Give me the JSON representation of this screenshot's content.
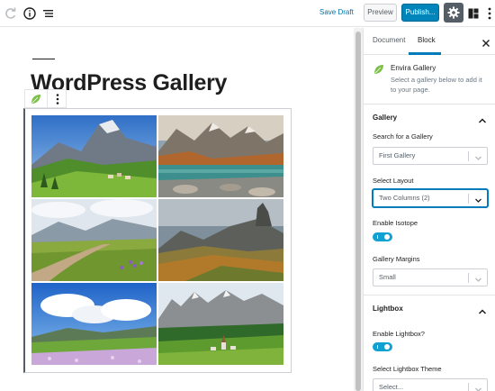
{
  "toolbar": {
    "save_draft": "Save Draft",
    "preview": "Preview",
    "publish": "Publish..."
  },
  "editor": {
    "post_title": "WordPress Gallery",
    "gallery_photos": [
      {
        "subject": "mountain village meadow"
      },
      {
        "subject": "alpine lake with rocks"
      },
      {
        "subject": "dirt road through valley"
      },
      {
        "subject": "rocky peaks autumn"
      },
      {
        "subject": "flower meadow blue sky"
      },
      {
        "subject": "dolomites village church"
      }
    ]
  },
  "sidebar": {
    "tabs": [
      "Document",
      "Block"
    ],
    "active_tab": "Block",
    "block": {
      "title": "Envira Gallery",
      "description": "Select a gallery below to add it to your page."
    },
    "gallery_panel": {
      "title": "Gallery",
      "search_label": "Search for a Gallery",
      "search_value": "First Gallery",
      "layout_label": "Select Layout",
      "layout_value": "Two Columns (2)",
      "isotope_label": "Enable Isotope",
      "margins_label": "Gallery Margins",
      "margins_value": "Small"
    },
    "lightbox_panel": {
      "title": "Lightbox",
      "enable_label": "Enable Lightbox?",
      "theme_label": "Select Lightbox Theme",
      "theme_value": "Select..."
    }
  },
  "colors": {
    "accent": "#007cba",
    "publish": "#0085ba",
    "toggle_on": "#11a0d2",
    "envira_green": "#7cc048"
  },
  "icons": [
    "redo-icon",
    "info-icon",
    "outline-icon",
    "gear-icon",
    "blocks-icon",
    "more-vertical-icon",
    "envira-leaf-icon",
    "close-icon",
    "chevron-up-icon",
    "chevron-down-icon"
  ]
}
